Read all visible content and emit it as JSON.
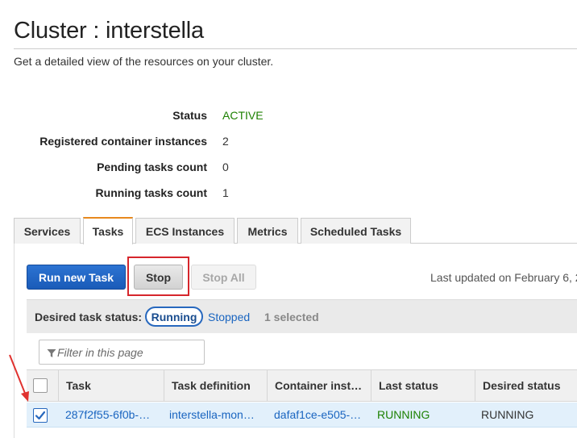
{
  "header": {
    "title": "Cluster : interstella",
    "subtitle": "Get a detailed view of the resources on your cluster."
  },
  "summary": [
    {
      "label": "Status",
      "value": "ACTIVE"
    },
    {
      "label": "Registered container instances",
      "value": "2"
    },
    {
      "label": "Pending tasks count",
      "value": "0"
    },
    {
      "label": "Running tasks count",
      "value": "1"
    }
  ],
  "colors": {
    "active_status": "#1d8102",
    "primary_button": "#1a5bb8",
    "link": "#1a65c0",
    "highlight": "#d6262c",
    "active_tab_accent": "#e8891d"
  },
  "tabs": [
    {
      "label": "Services",
      "active": false
    },
    {
      "label": "Tasks",
      "active": true
    },
    {
      "label": "ECS Instances",
      "active": false
    },
    {
      "label": "Metrics",
      "active": false
    },
    {
      "label": "Scheduled Tasks",
      "active": false
    }
  ],
  "toolbar": {
    "run_new_task": "Run new Task",
    "stop": "Stop",
    "stop_all": "Stop All",
    "last_updated": "Last updated on February 6, 2"
  },
  "filters": {
    "desired_status_label": "Desired task status:",
    "running": "Running",
    "stopped": "Stopped",
    "selected": "1 selected",
    "filter_placeholder": "Filter in this page",
    "filter_icon": "funnel-icon"
  },
  "table": {
    "columns": [
      "Task",
      "Task definition",
      "Container inst…",
      "Last status",
      "Desired status"
    ],
    "rows": [
      {
        "checked": true,
        "task": "287f2f55-6f0b-…",
        "task_definition": "interstella-mon…",
        "container_instance": "dafaf1ce-e505-…",
        "last_status": "RUNNING",
        "desired_status": "RUNNING"
      }
    ]
  }
}
